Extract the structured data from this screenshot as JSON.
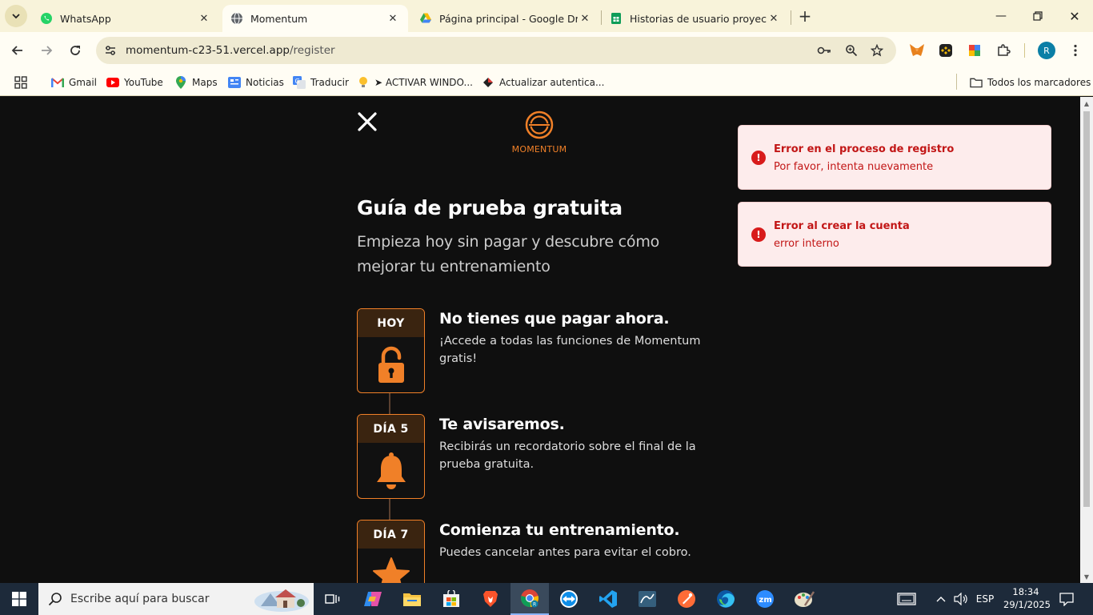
{
  "browser": {
    "tabs": [
      {
        "title": "WhatsApp",
        "icon": "whatsapp-icon",
        "active": false
      },
      {
        "title": "Momentum",
        "icon": "globe-icon",
        "active": true
      },
      {
        "title": "Página principal - Google Drive",
        "icon": "google-drive-icon",
        "active": false
      },
      {
        "title": "Historias de usuario proyecto N",
        "icon": "google-sheets-icon",
        "active": false
      }
    ],
    "url_host": "momentum-c23-51.vercel.app",
    "url_path": "/register",
    "profile_initial": "R",
    "bookmarks": [
      {
        "label": "Gmail",
        "icon": "gmail-icon"
      },
      {
        "label": "YouTube",
        "icon": "youtube-icon"
      },
      {
        "label": "Maps",
        "icon": "maps-icon"
      },
      {
        "label": "Noticias",
        "icon": "news-icon"
      },
      {
        "label": "Traducir",
        "icon": "translate-icon"
      },
      {
        "label": "➤ ACTIVAR WINDO...",
        "icon": "bulb-icon"
      },
      {
        "label": "Actualizar autentica...",
        "icon": "diamond-icon"
      }
    ],
    "all_bookmarks_label": "Todos los marcadores"
  },
  "page": {
    "logo_text": "MOMENTUM",
    "title": "Guía de prueba gratuita",
    "subtitle": "Empieza hoy sin pagar y descubre cómo mejorar tu entrenamiento",
    "steps": [
      {
        "label": "HOY",
        "icon": "unlock-icon",
        "title": "No tienes que pagar ahora.",
        "text": "¡Accede a todas las funciones de Momentum gratis!"
      },
      {
        "label": "DÍA 5",
        "icon": "bell-icon",
        "title": "Te avisaremos.",
        "text": "Recibirás un recordatorio sobre el final de la prueba gratuita."
      },
      {
        "label": "DÍA 7",
        "icon": "star-icon",
        "title": "Comienza tu entrenamiento.",
        "text": "Puedes cancelar antes para evitar el cobro."
      }
    ],
    "toasts": [
      {
        "title": "Error en el proceso de registro",
        "message": "Por favor, intenta nuevamente"
      },
      {
        "title": "Error al crear la cuenta",
        "message": "error interno"
      }
    ],
    "colors": {
      "accent": "#f08028",
      "error": "#c21616",
      "background": "#0f0f0f"
    }
  },
  "taskbar": {
    "search_placeholder": "Escribe aquí para buscar",
    "language": "ESP",
    "time": "18:34",
    "date": "29/1/2025"
  }
}
